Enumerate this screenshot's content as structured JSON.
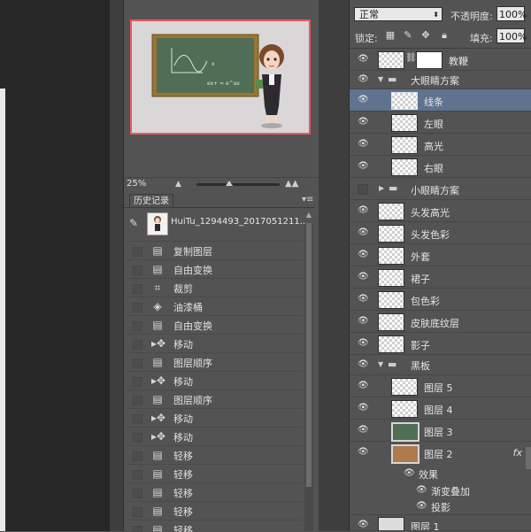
{
  "navigator": {
    "zoom": "25%"
  },
  "history": {
    "tab_label": "历史记录",
    "snapshot_label": "HuiTu_1294493_2017051211...",
    "steps": [
      {
        "label": "复制图层",
        "icon": "layer-icon"
      },
      {
        "label": "自由变换",
        "icon": "layer-icon"
      },
      {
        "label": "裁剪",
        "icon": "crop-icon"
      },
      {
        "label": "油漆桶",
        "icon": "paint-bucket-icon"
      },
      {
        "label": "自由变换",
        "icon": "layer-icon"
      },
      {
        "label": "移动",
        "icon": "move-icon"
      },
      {
        "label": "图层顺序",
        "icon": "layer-icon"
      },
      {
        "label": "移动",
        "icon": "move-icon"
      },
      {
        "label": "图层顺序",
        "icon": "layer-icon"
      },
      {
        "label": "移动",
        "icon": "move-icon"
      },
      {
        "label": "移动",
        "icon": "move-icon"
      },
      {
        "label": "轻移",
        "icon": "layer-icon"
      },
      {
        "label": "轻移",
        "icon": "layer-icon"
      },
      {
        "label": "轻移",
        "icon": "layer-icon"
      },
      {
        "label": "轻移",
        "icon": "layer-icon"
      },
      {
        "label": "轻移",
        "icon": "layer-icon"
      }
    ]
  },
  "layers": {
    "blend_mode": "正常",
    "opacity_label": "不透明度:",
    "opacity_value": "100%",
    "lock_label": "锁定:",
    "fill_label": "填充:",
    "fill_value": "100%",
    "items": [
      {
        "label": "教鞭",
        "type": "layer-mask",
        "visible": true
      },
      {
        "label": "大眼睛方案",
        "type": "group-open",
        "visible": true
      },
      {
        "label": "线条",
        "type": "layer-indented",
        "visible": true,
        "selected": true
      },
      {
        "label": "左眼",
        "type": "layer-indented",
        "visible": true
      },
      {
        "label": "高光",
        "type": "layer-indented",
        "visible": true
      },
      {
        "label": "右眼",
        "type": "layer-indented",
        "visible": true
      },
      {
        "label": "小眼睛方案",
        "type": "group-closed",
        "visible": false
      },
      {
        "label": "头发高光",
        "type": "layer",
        "visible": true
      },
      {
        "label": "头发色彩",
        "type": "layer",
        "visible": true
      },
      {
        "label": "外套",
        "type": "layer",
        "visible": true
      },
      {
        "label": "裙子",
        "type": "layer",
        "visible": true
      },
      {
        "label": "包色彩",
        "type": "layer",
        "visible": true
      },
      {
        "label": "皮肤底纹层",
        "type": "layer",
        "visible": true
      },
      {
        "label": "影子",
        "type": "layer",
        "visible": true
      },
      {
        "label": "黑板",
        "type": "group-open",
        "visible": true
      },
      {
        "label": "图层 5",
        "type": "layer-indented",
        "visible": true
      },
      {
        "label": "图层 4",
        "type": "layer-indented",
        "visible": true
      },
      {
        "label": "图层 3",
        "type": "layer-indented-green",
        "visible": true
      },
      {
        "label": "图层 2",
        "type": "layer-indented-brown",
        "visible": true,
        "fx": "fx"
      }
    ],
    "effects_label": "效果",
    "effects": [
      "渐变叠加",
      "投影"
    ],
    "bottom_layer": "图层 1"
  },
  "colors": {
    "selected_row": "#5f7390",
    "nav_frame": "#e8585d",
    "chalkboard": "#4f6e55"
  }
}
